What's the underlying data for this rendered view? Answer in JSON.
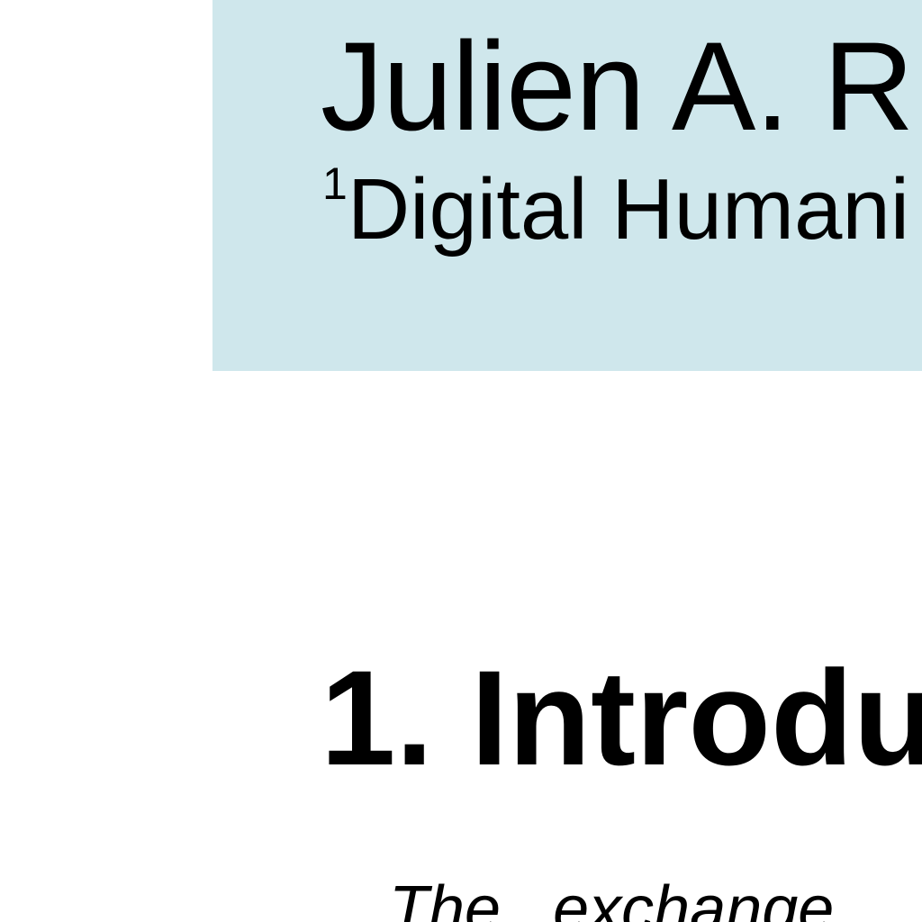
{
  "header": {
    "author": "Julien A. R",
    "affiliation_sup": "1",
    "affiliation": "Digital Humani",
    "background_color": "#cfe7ec"
  },
  "section": {
    "heading": "1. Introdu"
  },
  "body": {
    "text": "The exchange"
  }
}
